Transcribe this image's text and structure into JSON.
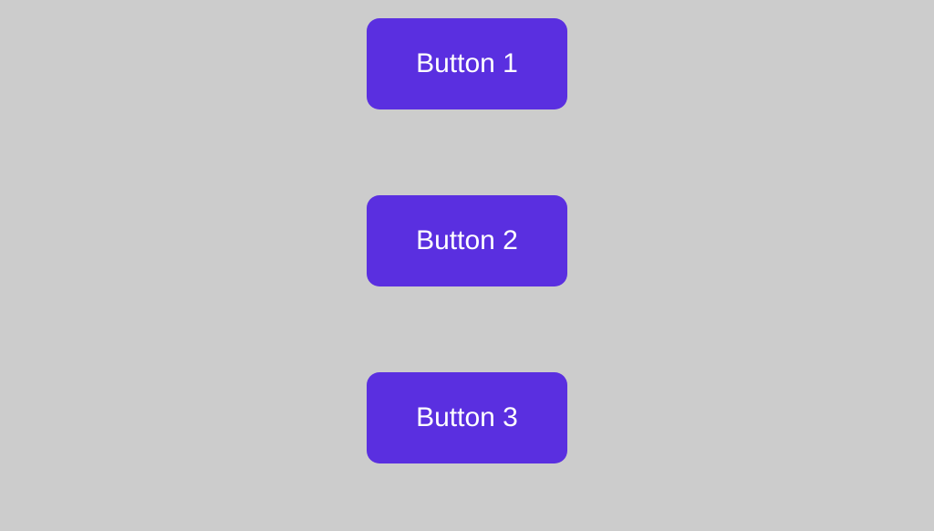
{
  "buttons": [
    {
      "label": "Button 1"
    },
    {
      "label": "Button 2"
    },
    {
      "label": "Button 3"
    }
  ],
  "colors": {
    "background": "#cccccc",
    "button_bg": "#5A2FE0",
    "button_text": "#ffffff"
  }
}
